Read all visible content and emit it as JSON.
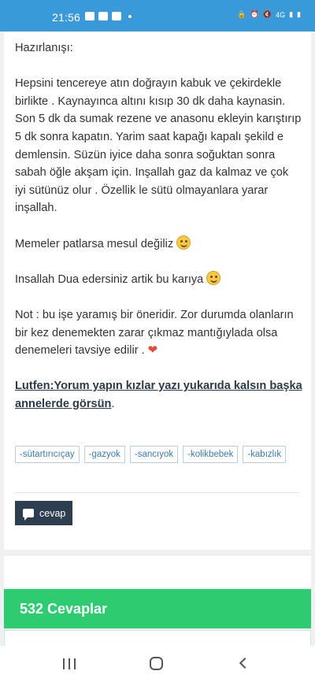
{
  "status_bar": {
    "time": "21:56",
    "network": "4G"
  },
  "post": {
    "heading": "Hazırlanışı:",
    "paragraph1": "Hepsini tencereye atın doğrayın kabuk ve çekirdekle birlikte . Kaynayınca altını kısıp 30 dk daha kaynasin. Son 5 dk da sumak rezene ve anasonu ekleyin karıştırıp 5 dk sonra kapatın. Yarim saat kapağı kapalı şekild e demlensin.  Süzün iyice daha sonra soğuktan sonra sabah öğle akşam için.  Inşallah gaz da kalmaz ve çok iyi sütünüz olur . Özellik le sütü olmayanlara yarar inşallah.",
    "line_meme": "Memeler patlarsa mesul değiliz",
    "line_dua": "Insallah Dua edersiniz artik bu karıya",
    "line_note": "Not : bu işe yaramış bir öneridir.  Zor durumda olanların bir kez denemekten zarar çıkmaz mantığıylada olsa denemeleri tavsiye edilir .",
    "cta_text": "Lutfen:Yorum yapın kızlar yazı yukarıda kalsın başka annelerde görsün",
    "cta_period": "."
  },
  "tags": [
    "-sütartırıcıçay",
    "-gazyok",
    "-sancıyok",
    "-kolikbebek",
    "-kabızlık"
  ],
  "reply_button": {
    "label": "cevap",
    "icon": "chat-bubble-icon"
  },
  "answers": {
    "label": "532 Cevaplar"
  },
  "colors": {
    "status_bar": "#3a9ad9",
    "answers_bar": "#2ecc71",
    "reply_button": "#2c3e50",
    "tag_text": "#3a7bb0"
  }
}
